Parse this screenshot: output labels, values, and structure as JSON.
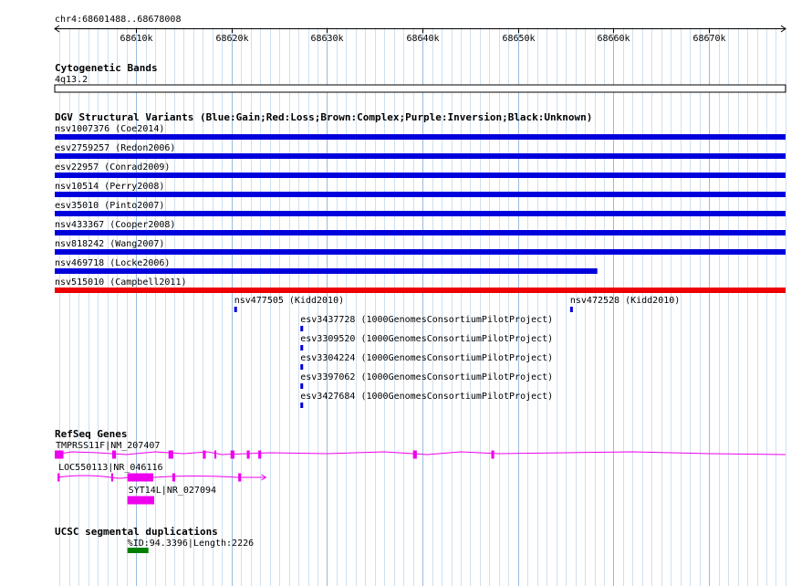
{
  "window": {
    "title": ""
  },
  "ruler": {
    "location": "chr4:68601488..68678008",
    "start": 68601488,
    "end": 68678008,
    "ticks": [
      {
        "pos": 68610000,
        "label": "68610k"
      },
      {
        "pos": 68620000,
        "label": "68620k"
      },
      {
        "pos": 68630000,
        "label": "68630k"
      },
      {
        "pos": 68640000,
        "label": "68640k"
      },
      {
        "pos": 68650000,
        "label": "68650k"
      },
      {
        "pos": 68660000,
        "label": "68660k"
      },
      {
        "pos": 68670000,
        "label": "68670k"
      }
    ],
    "grid_step": 1000
  },
  "cytoband": {
    "title": "Cytogenetic Bands",
    "band": "4q13.2"
  },
  "dgv": {
    "title": "DGV Structural Variants (Blue:Gain;Red:Loss;Brown:Complex;Purple:Inversion;Black:Unknown)",
    "colors": {
      "gain": "#0000dd",
      "loss": "#ee0000"
    },
    "variants": [
      {
        "label": "nsv1007376 (Coe2014)",
        "type": "gain",
        "start": 68601488,
        "end": 68678008
      },
      {
        "label": "esv2759257 (Redon2006)",
        "type": "gain",
        "start": 68601488,
        "end": 68678008
      },
      {
        "label": "esv22957 (Conrad2009)",
        "type": "gain",
        "start": 68601488,
        "end": 68678008
      },
      {
        "label": "nsv10514 (Perry2008)",
        "type": "gain",
        "start": 68601488,
        "end": 68678008
      },
      {
        "label": "esv35010 (Pinto2007)",
        "type": "gain",
        "start": 68601488,
        "end": 68678008
      },
      {
        "label": "nsv433367 (Cooper2008)",
        "type": "gain",
        "start": 68601488,
        "end": 68678008
      },
      {
        "label": "nsv818242 (Wang2007)",
        "type": "gain",
        "start": 68601488,
        "end": 68678008
      },
      {
        "label": "nsv469718 (Locke2006)",
        "type": "gain",
        "start": 68601488,
        "end": 68658300
      },
      {
        "label": "nsv515010 (Campbell2011)",
        "type": "loss",
        "start": 68601488,
        "end": 68678008
      }
    ],
    "small_variants": [
      {
        "label": "nsv477505 (Kidd2010)",
        "type": "gain",
        "start": 68620280,
        "end": 68620380,
        "row": 0
      },
      {
        "label": "nsv472528 (Kidd2010)",
        "type": "gain",
        "start": 68655450,
        "end": 68655550,
        "row": 0
      },
      {
        "label": "esv3437728 (1000GenomesConsortiumPilotProject)",
        "type": "gain",
        "start": 68627210,
        "end": 68627330,
        "row": 1
      },
      {
        "label": "esv3309520 (1000GenomesConsortiumPilotProject)",
        "type": "gain",
        "start": 68627210,
        "end": 68627330,
        "row": 2
      },
      {
        "label": "esv3304224 (1000GenomesConsortiumPilotProject)",
        "type": "gain",
        "start": 68627210,
        "end": 68627330,
        "row": 3
      },
      {
        "label": "esv3397062 (1000GenomesConsortiumPilotProject)",
        "type": "gain",
        "start": 68627210,
        "end": 68627330,
        "row": 4
      },
      {
        "label": "esv3427684 (1000GenomesConsortiumPilotProject)",
        "type": "gain",
        "start": 68627210,
        "end": 68627330,
        "row": 5
      }
    ]
  },
  "refseq": {
    "title": "RefSeq Genes",
    "color": "#ee00ee",
    "genes": [
      {
        "label": "TMPRSS11F|NM_207407",
        "start": 68601488,
        "end": 68678008,
        "row": 0,
        "strand": "-",
        "exons": [
          [
            68601488,
            68602400
          ],
          [
            68607500,
            68607900
          ],
          [
            68613400,
            68613900
          ],
          [
            68617000,
            68617300
          ],
          [
            68618200,
            68618400
          ],
          [
            68619900,
            68620300
          ],
          [
            68621600,
            68621900
          ],
          [
            68622800,
            68623100
          ],
          [
            68639000,
            68639400
          ],
          [
            68647200,
            68647500
          ]
        ]
      },
      {
        "label": "LOC550113|NR_046116",
        "start": 68601788,
        "end": 68623600,
        "row": 1,
        "strand": "+",
        "exons": [
          [
            68601788,
            68602000
          ],
          [
            68607400,
            68607600
          ],
          [
            68609100,
            68611800
          ],
          [
            68613800,
            68614100
          ],
          [
            68620700,
            68621000
          ]
        ]
      },
      {
        "label": "SYT14L|NR_027094",
        "start": 68609100,
        "end": 68611900,
        "row": 2,
        "strand": "",
        "exons": [
          [
            68609100,
            68611900
          ]
        ]
      }
    ]
  },
  "segdup": {
    "title": "UCSC segmental duplications",
    "color": "#008000",
    "items": [
      {
        "label": "%ID:94.3396|Length:2226",
        "start": 68609100,
        "end": 68611300
      }
    ]
  }
}
